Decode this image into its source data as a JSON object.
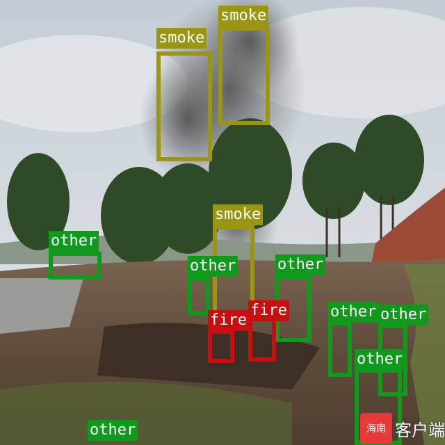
{
  "colors": {
    "smoke": "#9a9612",
    "fire": "#c80e0e",
    "other": "#0f9a1c"
  },
  "detections": [
    {
      "label": "smoke",
      "cls": "smoke"
    },
    {
      "label": "smoke",
      "cls": "smoke"
    },
    {
      "label": "smoke",
      "cls": "smoke"
    },
    {
      "label": "other",
      "cls": "other"
    },
    {
      "label": "other",
      "cls": "other"
    },
    {
      "label": "other",
      "cls": "other"
    },
    {
      "label": "fire",
      "cls": "fire"
    },
    {
      "label": "fire",
      "cls": "fire"
    },
    {
      "label": "other",
      "cls": "other"
    },
    {
      "label": "other",
      "cls": "other"
    },
    {
      "label": "other",
      "cls": "other"
    },
    {
      "label": "other",
      "cls": "other"
    }
  ],
  "watermark": {
    "logo_text": "海南",
    "text": "客户端"
  }
}
